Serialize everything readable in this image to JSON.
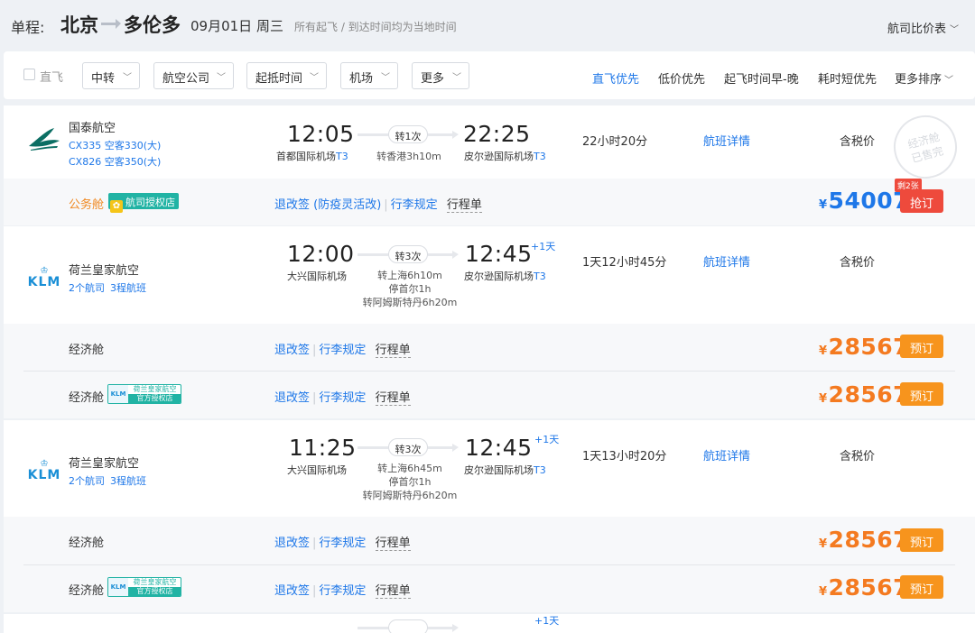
{
  "header": {
    "trip_label": "单程:",
    "from_city": "北京",
    "to_city": "多伦多",
    "date": "09月01日 周三",
    "note": "所有起飞 / 到达时间均为当地时间",
    "compare_label": "航司比价表",
    "compare_icon": "chevron-down-icon"
  },
  "filters": {
    "direct_label": "直飞",
    "items": [
      {
        "label": "中转"
      },
      {
        "label": "航空公司"
      },
      {
        "label": "起抵时间"
      },
      {
        "label": "机场"
      },
      {
        "label": "更多"
      }
    ],
    "sorts": [
      {
        "label": "直飞优先",
        "active": true
      },
      {
        "label": "低价优先"
      },
      {
        "label": "起飞时间早-晚"
      },
      {
        "label": "耗时短优先"
      },
      {
        "label": "更多排序"
      }
    ]
  },
  "flights": [
    {
      "airline": "国泰航空",
      "logo": "cathay-logo",
      "sub1": "CX335 空客330(大)",
      "sub2": "CX826 空客350(大)",
      "dep_time": "12:05",
      "dep_airport": "首都国际机场",
      "dep_terminal": "T3",
      "stops": "转1次",
      "transit": [
        "转香港3h10m"
      ],
      "arr_time": "22:25",
      "arr_airport": "皮尔逊国际机场",
      "arr_terminal": "T3",
      "plus_day": "",
      "duration": "22小时20分",
      "detail_label": "航班详情",
      "tax_label": "含税价",
      "stamp_line1": "经济舱",
      "stamp_line2": "已售完",
      "fares": [
        {
          "cabin": "公务舱",
          "badge": "航司授权店",
          "links": [
            "退改签 (防疫灵活改)",
            "行李规定"
          ],
          "itinerary": "行程单",
          "currency": "¥",
          "price": "54007",
          "remain": "剩2张",
          "button": "抢订"
        }
      ]
    },
    {
      "airline": "荷兰皇家航空",
      "logo": "klm-logo",
      "logo_text": "KLM",
      "sub1": "2个航司",
      "sub2": "3程航班",
      "dep_time": "12:00",
      "dep_airport": "大兴国际机场",
      "dep_terminal": "",
      "stops": "转3次",
      "transit": [
        "转上海6h10m",
        "停首尔1h",
        "转阿姆斯特丹6h20m"
      ],
      "arr_time": "12:45",
      "arr_airport": "皮尔逊国际机场",
      "arr_terminal": "T3",
      "plus_day": "+1天",
      "duration": "1天12小时45分",
      "detail_label": "航班详情",
      "tax_label": "含税价",
      "fares": [
        {
          "cabin": "经济舱",
          "links": [
            "退改签",
            "行李规定"
          ],
          "itinerary": "行程单",
          "currency": "¥",
          "price": "28567",
          "button": "预订"
        },
        {
          "cabin": "经济舱",
          "badge_top": "荷兰皇家航空",
          "badge_bottom": "官方授权店",
          "links": [
            "退改签",
            "行李规定"
          ],
          "itinerary": "行程单",
          "currency": "¥",
          "price": "28567",
          "button": "预订"
        }
      ]
    },
    {
      "airline": "荷兰皇家航空",
      "logo": "klm-logo",
      "logo_text": "KLM",
      "sub1": "2个航司",
      "sub2": "3程航班",
      "dep_time": "11:25",
      "dep_airport": "大兴国际机场",
      "dep_terminal": "",
      "stops": "转3次",
      "transit": [
        "转上海6h45m",
        "停首尔1h",
        "转阿姆斯特丹6h20m"
      ],
      "arr_time": "12:45",
      "arr_airport": "皮尔逊国际机场",
      "arr_terminal": "T3",
      "plus_day": "+1天",
      "duration": "1天13小时20分",
      "detail_label": "航班详情",
      "tax_label": "含税价",
      "fares": [
        {
          "cabin": "经济舱",
          "links": [
            "退改签",
            "行李规定"
          ],
          "itinerary": "行程单",
          "currency": "¥",
          "price": "28567",
          "button": "预订"
        },
        {
          "cabin": "经济舱",
          "badge_top": "荷兰皇家航空",
          "badge_bottom": "官方授权店",
          "links": [
            "退改签",
            "行李规定"
          ],
          "itinerary": "行程单",
          "currency": "¥",
          "price": "28567",
          "button": "预订"
        }
      ]
    },
    {
      "plus_day": "+1天"
    }
  ],
  "colors": {
    "accent_blue": "#1e77e8",
    "price_orange": "#f47a20",
    "button_orange": "#f7941d",
    "button_red": "#ee4a3c",
    "badge_green": "#21b3a4"
  }
}
